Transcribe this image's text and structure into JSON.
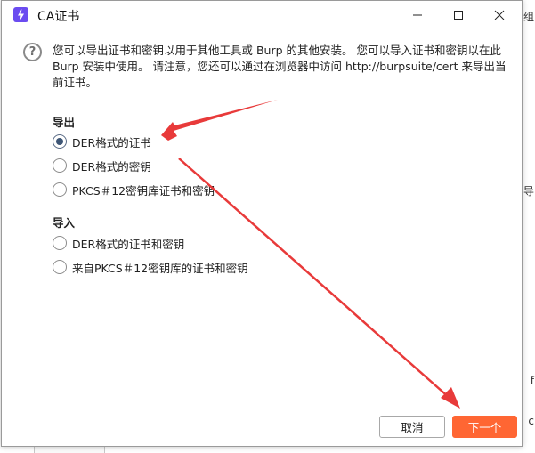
{
  "window": {
    "title": "CA证书"
  },
  "intro": {
    "text": "您可以导出证书和密钥以用于其他工具或 Burp 的其他安装。 您可以导入证书和密钥以在此 Burp 安装中使用。 请注意，您还可以通过在浏览器中访问 http://burpsuite/cert 来导出当前证书。"
  },
  "export": {
    "title": "导出",
    "options": [
      {
        "label": "DER格式的证书",
        "checked": true
      },
      {
        "label": "DER格式的密钥",
        "checked": false
      },
      {
        "label": "PKCS＃12密钥库证书和密钥",
        "checked": false
      }
    ]
  },
  "import": {
    "title": "导入",
    "options": [
      {
        "label": "DER格式的证书和密钥",
        "checked": false
      },
      {
        "label": "来自PKCS＃12密钥库的证书和密钥",
        "checked": false
      }
    ]
  },
  "buttons": {
    "cancel": "取消",
    "next": "下一个"
  },
  "background": {
    "fragments": [
      "组",
      "导",
      "f",
      "c"
    ]
  },
  "colors": {
    "accent": "#ff6633",
    "arrow": "#e83a3a",
    "app_icon": "#6b4cf0"
  }
}
